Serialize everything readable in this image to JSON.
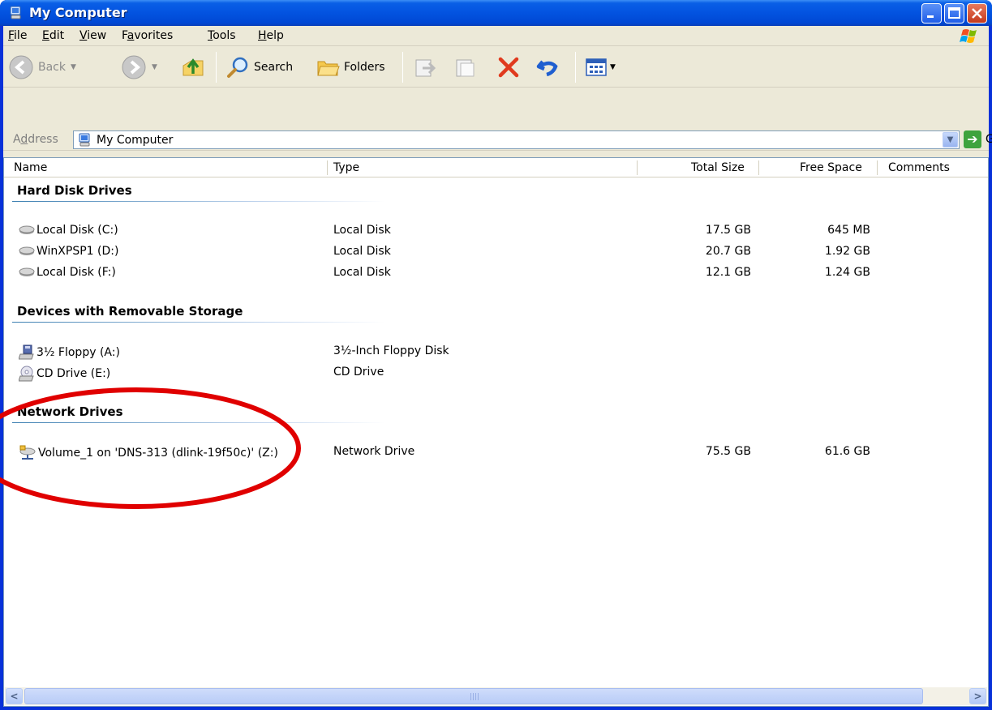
{
  "window": {
    "title": "My Computer"
  },
  "menu": [
    {
      "key": "F",
      "rest": "ile"
    },
    {
      "key": "E",
      "rest": "dit"
    },
    {
      "key": "V",
      "rest": "iew"
    },
    {
      "pre": "F",
      "key": "a",
      "rest": "vorites"
    },
    {
      "key": "T",
      "rest": "ools"
    },
    {
      "key": "H",
      "rest": "elp"
    }
  ],
  "toolbar": {
    "back_label": "Back",
    "search_label": "Search",
    "folders_label": "Folders"
  },
  "address": {
    "label_pre": "A",
    "label_key": "d",
    "label_rest": "dress",
    "value": "My Computer",
    "go_label": "Go"
  },
  "columns": {
    "name": "Name",
    "type": "Type",
    "total_size": "Total Size",
    "free_space": "Free Space",
    "comments": "Comments"
  },
  "groups": [
    {
      "title": "Hard Disk Drives",
      "items": [
        {
          "name": "Local Disk (C:)",
          "type": "Local Disk",
          "total": "17.5 GB",
          "free": "645 MB",
          "icon": "hard-disk-icon"
        },
        {
          "name": "WinXPSP1 (D:)",
          "type": "Local Disk",
          "total": "20.7 GB",
          "free": "1.92 GB",
          "icon": "hard-disk-icon"
        },
        {
          "name": "Local Disk (F:)",
          "type": "Local Disk",
          "total": "12.1 GB",
          "free": "1.24 GB",
          "icon": "hard-disk-icon"
        }
      ]
    },
    {
      "title": "Devices with Removable Storage",
      "items": [
        {
          "name": "3½ Floppy (A:)",
          "type": "3½-Inch Floppy Disk",
          "total": "",
          "free": "",
          "icon": "floppy-drive-icon"
        },
        {
          "name": "CD Drive (E:)",
          "type": "CD Drive",
          "total": "",
          "free": "",
          "icon": "cd-drive-icon"
        }
      ]
    },
    {
      "title": "Network Drives",
      "items": [
        {
          "name": "Volume_1 on 'DNS-313 (dlink-19f50c)' (Z:)",
          "type": "Network Drive",
          "total": "75.5 GB",
          "free": "61.6 GB",
          "icon": "network-drive-icon"
        }
      ]
    }
  ],
  "colors": {
    "title_bar": "#0353e0",
    "frame": "#ece9d8",
    "annotation": "#e00000",
    "group_line": "#3c7fb1"
  }
}
